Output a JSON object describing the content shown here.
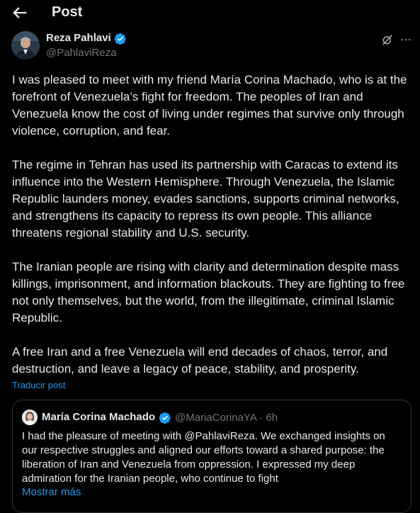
{
  "header": {
    "back_icon": "arrow-left-icon",
    "title": "Post"
  },
  "author": {
    "name": "Reza Pahlavi",
    "handle": "@PahlaviReza",
    "verified_icon": "verified-badge-icon",
    "verified_color": "#1d9bf0"
  },
  "actions": {
    "grok_icon": "grok-icon",
    "more_icon": "more-horizontal-icon"
  },
  "post": {
    "paragraphs": [
      "I was pleased to meet with my friend María Corina Machado, who is at the forefront of Venezuela’s fight for freedom. The peoples of Iran and Venezuela know the cost of living under regimes that survive only through violence, corruption, and fear.",
      "The regime in Tehran has used its partnership with Caracas to extend its influence into the Western Hemisphere. Through Venezuela, the Islamic Republic launders money, evades sanctions, supports criminal networks, and strengthens its capacity to repress its own people. This alliance threatens regional stability and U.S. security.",
      "The Iranian people are rising with clarity and determination despite mass killings, imprisonment, and information blackouts. They are fighting to free not only themselves, but the world, from the illegitimate, criminal Islamic Republic.",
      "A free Iran and a free Venezuela will end decades of chaos, terror, and destruction, and leave a legacy of peace, stability, and prosperity."
    ],
    "translate_label": "Traducir post"
  },
  "quote": {
    "name": "María Corina Machado",
    "handle_time": "@MariaCorinaYA · 6h",
    "text": "I had the pleasure of meeting with @PahlaviReza. We exchanged insights on our respective struggles and aligned our efforts toward a shared purpose: the liberation of Iran and Venezuela from oppression. I expressed my deep admiration for the Iranian people, who continue to fight",
    "show_more_label": "Mostrar más"
  },
  "colors": {
    "background": "#000000",
    "text": "#e7e9ea",
    "secondary": "#71767b",
    "accent": "#1d9bf0",
    "border": "#2f3336"
  }
}
